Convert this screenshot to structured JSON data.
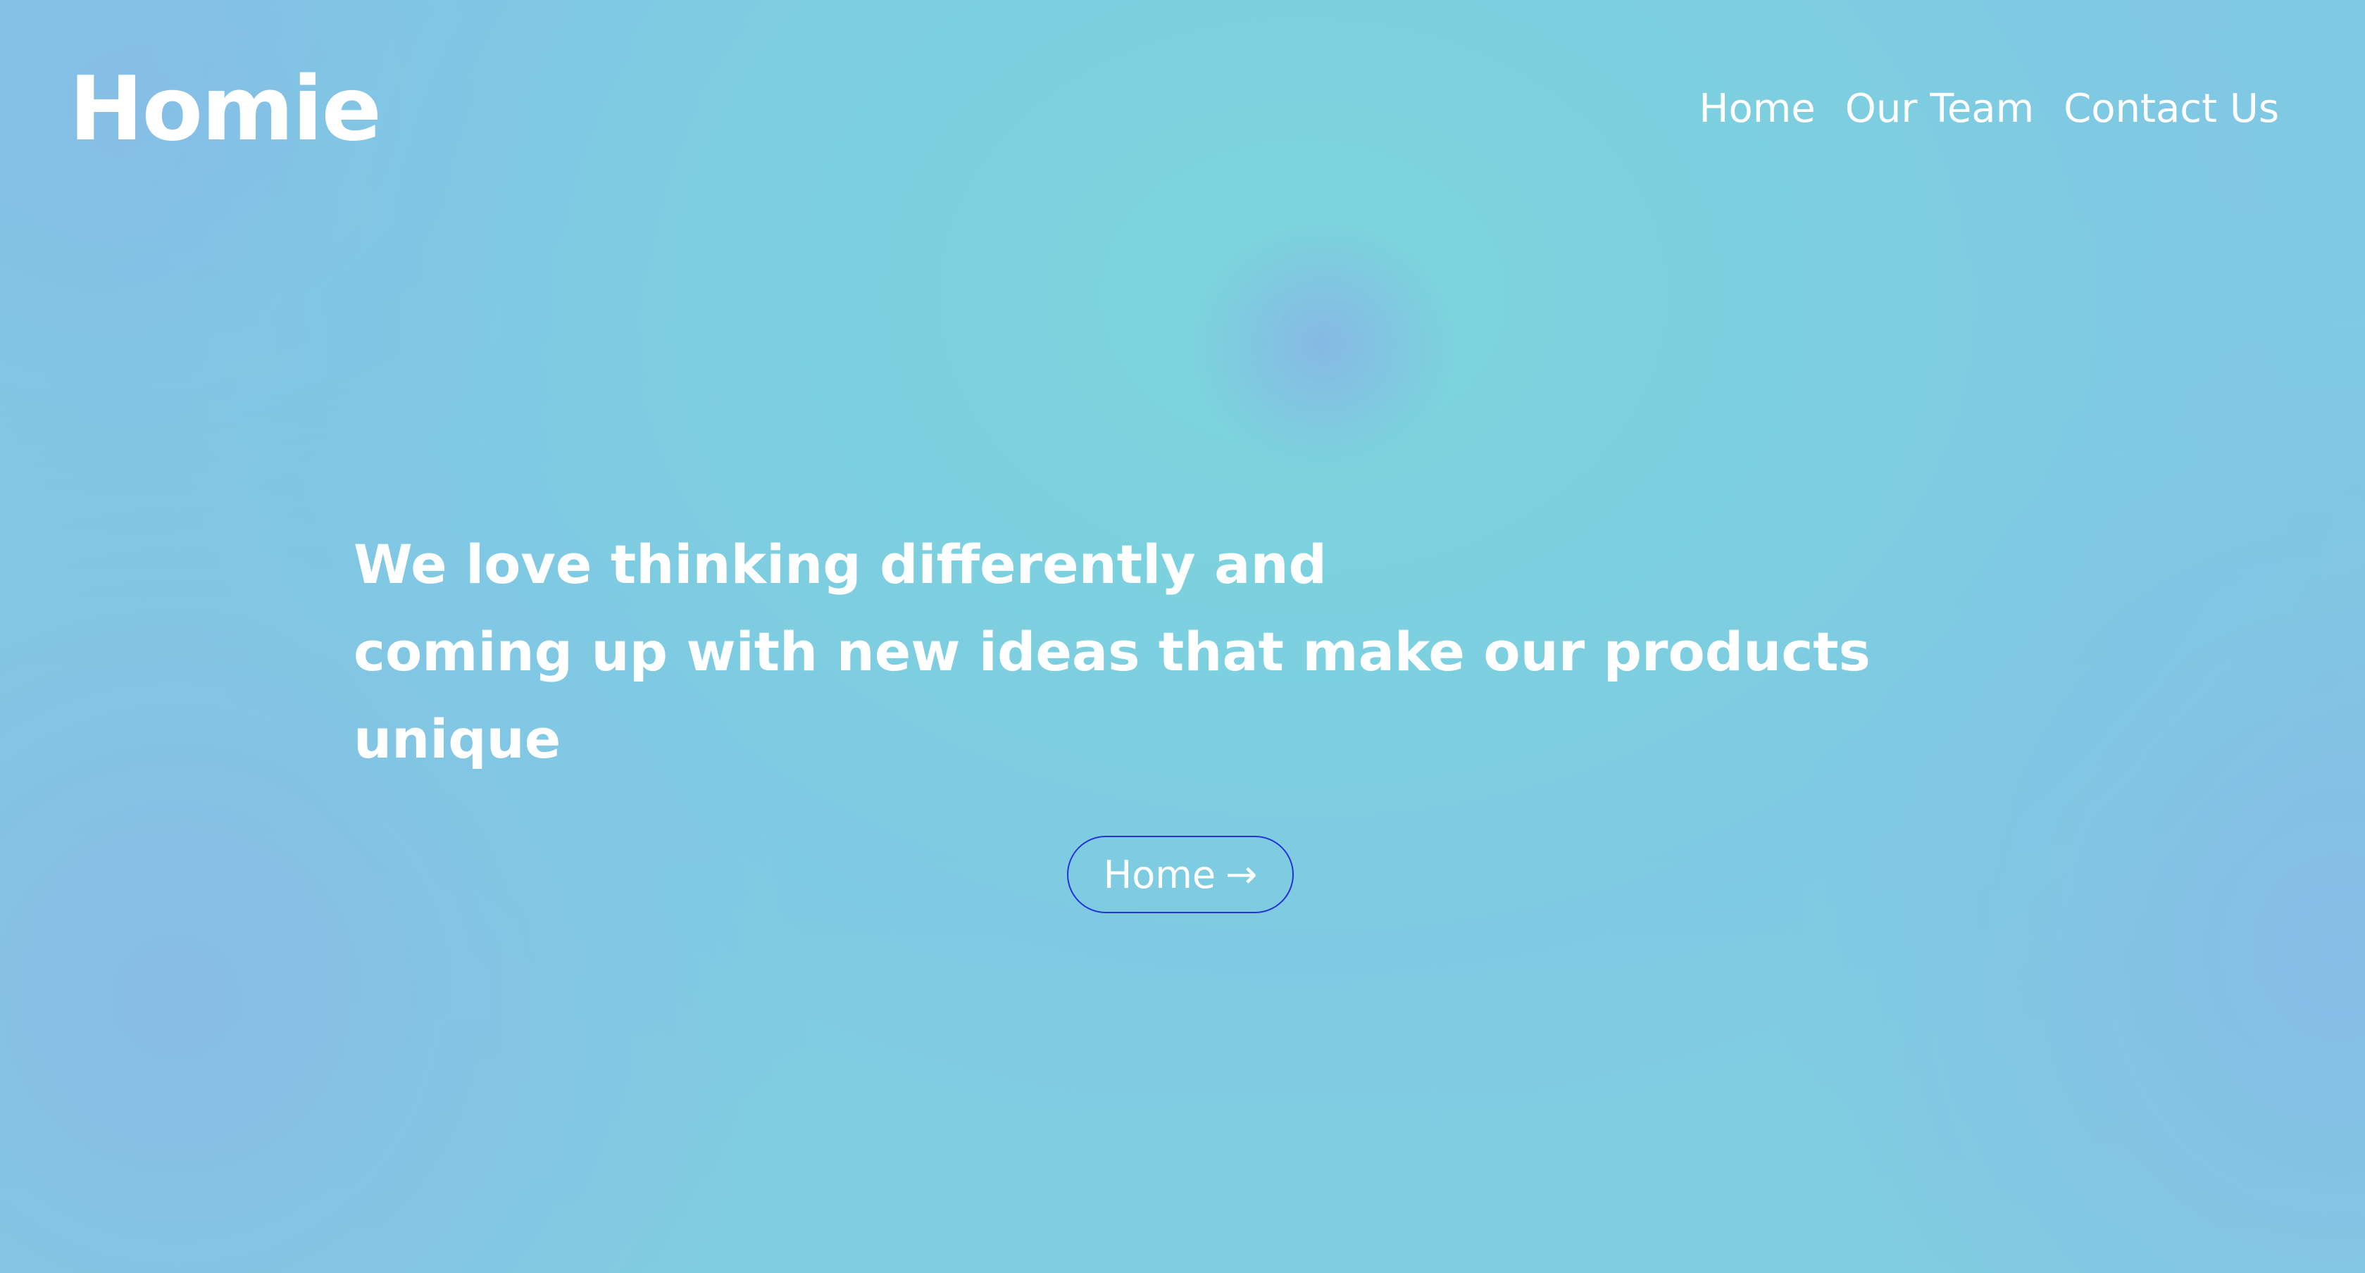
{
  "brand": {
    "name": "Homie"
  },
  "nav": {
    "items": [
      {
        "label": "Home"
      },
      {
        "label": "Our Team"
      },
      {
        "label": "Contact Us"
      }
    ]
  },
  "hero": {
    "lines": [
      "We love thinking differently and",
      "coming up with new ideas that make our products",
      "unique"
    ],
    "button": {
      "label": "Home",
      "icon": "arrow-right-icon",
      "border_color": "#2433d8"
    }
  },
  "colors": {
    "background_primary": "#7bd6dc",
    "background_secondary": "#86bde6",
    "text": "#ffffff"
  }
}
